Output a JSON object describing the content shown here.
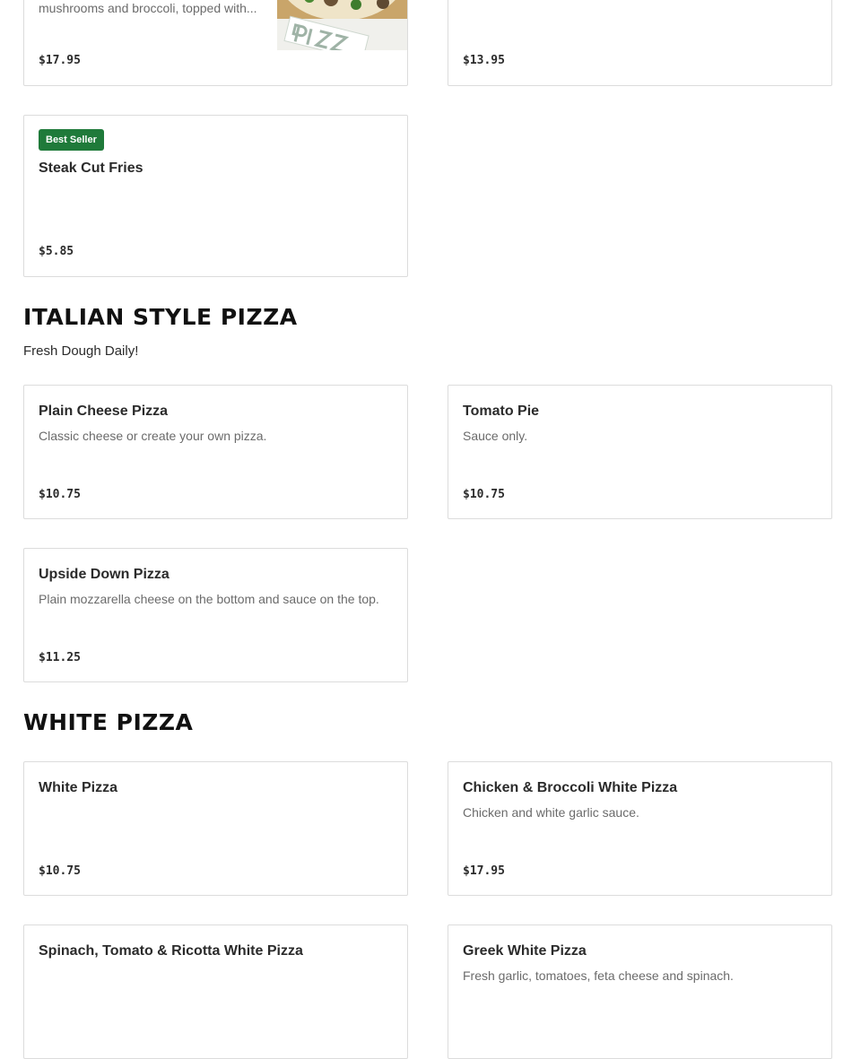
{
  "top_cards": [
    {
      "desc": "mushrooms and broccoli, topped with...",
      "price": "$17.95"
    },
    {
      "price": "$13.95"
    }
  ],
  "fries_card": {
    "badge": "Best Seller",
    "name": "Steak Cut Fries",
    "price": "$5.85"
  },
  "italian_section": {
    "title": "ITALIAN STYLE PIZZA",
    "subtitle": "Fresh Dough Daily!",
    "items": [
      {
        "name": "Plain Cheese Pizza",
        "desc": "Classic cheese or create your own pizza.",
        "price": "$10.75"
      },
      {
        "name": "Tomato Pie",
        "desc": "Sauce only.",
        "price": "$10.75"
      },
      {
        "name": "Upside Down Pizza",
        "desc": "Plain mozzarella cheese on the bottom and sauce on the top.",
        "price": "$11.25"
      }
    ]
  },
  "white_section": {
    "title": "WHITE PIZZA",
    "items": [
      {
        "name": "White Pizza",
        "price": "$10.75"
      },
      {
        "name": "Chicken & Broccoli White Pizza",
        "desc": "Chicken and white garlic sauce.",
        "price": "$17.95"
      },
      {
        "name": "Spinach, Tomato & Ricotta White Pizza"
      },
      {
        "name": "Greek White Pizza",
        "desc": "Fresh garlic, tomatoes, feta cheese and spinach."
      }
    ]
  },
  "colors": {
    "badge": "#1f7a3a",
    "border": "#dcdcdc",
    "text": "#2b2b2b",
    "muted": "#6b6b6b"
  },
  "icons": {
    "food_photo": "pizza-photo"
  }
}
